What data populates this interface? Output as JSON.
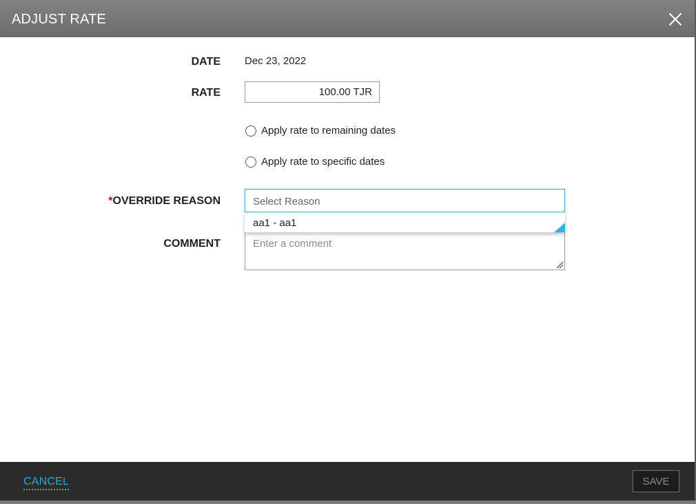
{
  "dialog": {
    "title": "ADJUST RATE",
    "close_icon": "close-icon"
  },
  "form": {
    "date_label": "DATE",
    "date_value": "Dec 23, 2022",
    "rate_label": "RATE",
    "rate_value": "100.00 TJR",
    "radio_options": [
      {
        "label": "Apply rate to remaining dates",
        "selected": false
      },
      {
        "label": "Apply rate to specific dates",
        "selected": false
      }
    ],
    "override_reason": {
      "required_mark": "*",
      "label": "OVERRIDE REASON",
      "placeholder": "Select Reason",
      "options": [
        "aa1 - aa1"
      ]
    },
    "comment": {
      "label": "COMMENT",
      "placeholder": "Enter a comment"
    }
  },
  "footer": {
    "cancel_label": "CANCEL",
    "save_label": "SAVE"
  },
  "colors": {
    "header_bg": "#777777",
    "footer_bg": "#2b2b2b",
    "accent": "#35b3d6",
    "required": "#d0021b"
  }
}
